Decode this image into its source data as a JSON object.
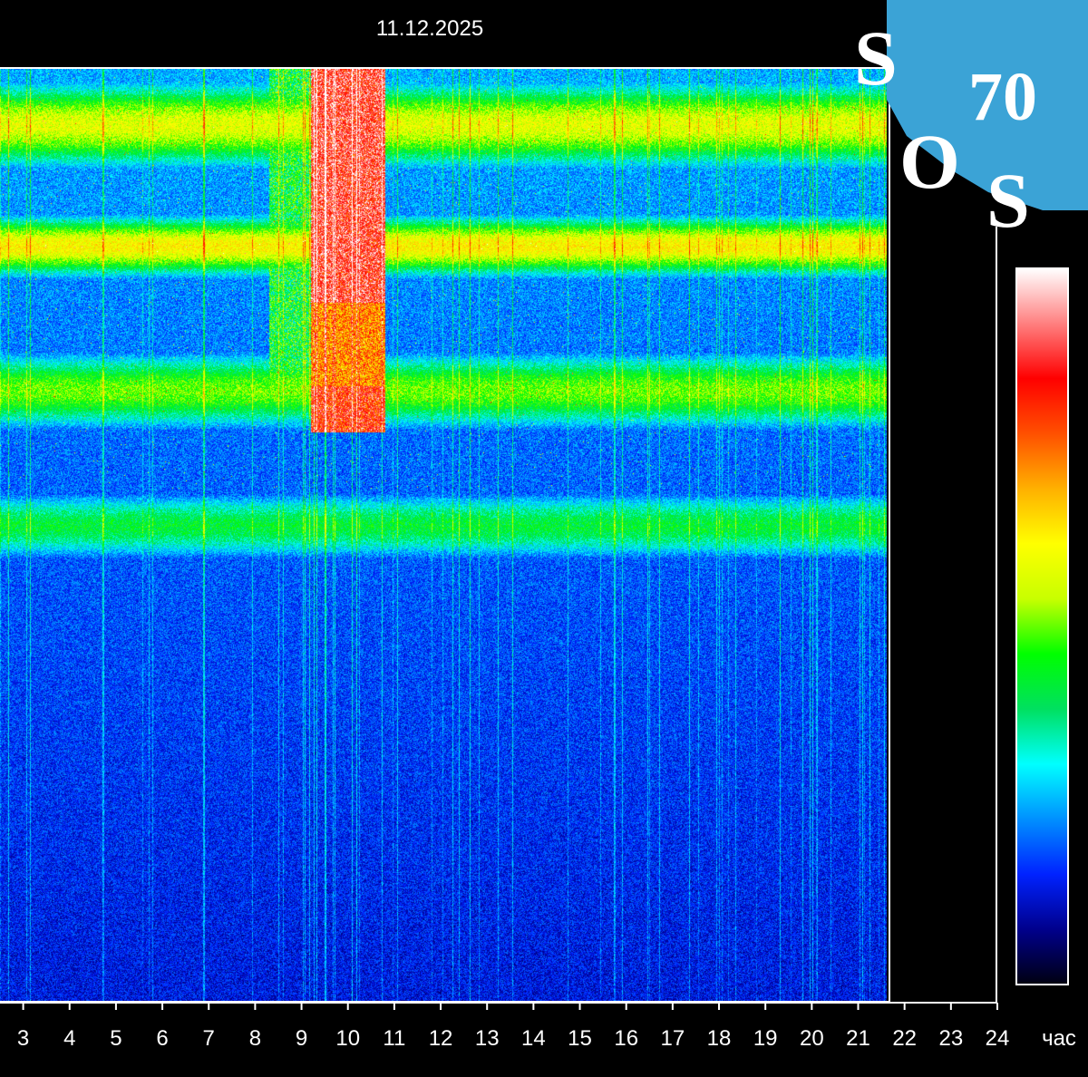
{
  "header": {
    "date": "11.12.2025"
  },
  "logo": {
    "text": "SOS 70",
    "color": "#3ba3d6"
  },
  "colors": {
    "background": "#000000",
    "frame": "#ffffff",
    "colormap": [
      "#000010",
      "#00008c",
      "#0022ff",
      "#0090ff",
      "#00ffff",
      "#00e060",
      "#00ff00",
      "#c8ff00",
      "#ffff00",
      "#ffb000",
      "#ff5000",
      "#ff0000",
      "#ff8080",
      "#ffffff"
    ]
  },
  "chart_data": {
    "type": "heatmap",
    "title": "11.12.2025",
    "xlabel": "час",
    "ylabel": "",
    "xlim": [
      2.5,
      24
    ],
    "x_ticks": [
      3,
      4,
      5,
      6,
      7,
      8,
      9,
      10,
      11,
      12,
      13,
      14,
      15,
      16,
      17,
      18,
      19,
      20,
      21,
      22,
      23,
      24
    ],
    "tick_labels": [
      "3",
      "4",
      "5",
      "6",
      "7",
      "8",
      "9",
      "10",
      "11",
      "12",
      "13",
      "14",
      "15",
      "16",
      "17",
      "18",
      "19",
      "20",
      "21",
      "22",
      "23",
      "24"
    ],
    "data_end_hour": 21.6,
    "frequency_axis": "unlabeled",
    "intensity_scale": "unlabeled colorbar, dark blue (low) to white (high)",
    "background_level": 0.22,
    "bands": [
      {
        "name": "",
        "center": 0.06,
        "width": 0.05,
        "intensity": 0.58
      },
      {
        "name": "",
        "center": 0.19,
        "width": 0.035,
        "intensity": 0.62
      },
      {
        "name": "",
        "center": 0.345,
        "width": 0.045,
        "intensity": 0.5
      },
      {
        "name": "",
        "center": 0.49,
        "width": 0.04,
        "intensity": 0.42
      }
    ],
    "events": [
      {
        "x_start": 9.2,
        "x_end": 10.8,
        "y_from": 0.0,
        "y_to": 0.25,
        "intensity": 1.0
      },
      {
        "x_start": 9.2,
        "x_end": 10.8,
        "y_from": 0.25,
        "y_to": 0.34,
        "intensity": 0.85
      },
      {
        "x_start": 9.2,
        "x_end": 10.8,
        "y_from": 0.34,
        "y_to": 0.39,
        "intensity": 0.95
      },
      {
        "x_start": 8.3,
        "x_end": 9.2,
        "y_from": 0.0,
        "y_to": 0.35,
        "intensity": 0.55
      }
    ],
    "grid": false
  }
}
